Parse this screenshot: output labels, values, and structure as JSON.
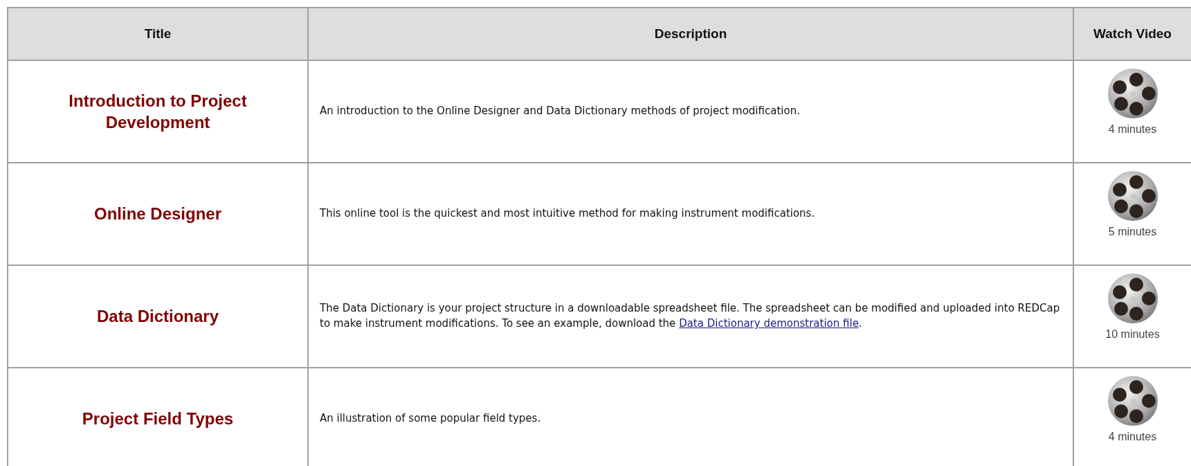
{
  "table": {
    "columns": [
      "Title",
      "Description",
      "Watch Video"
    ],
    "rows": [
      {
        "title": "Introduction to Project Development",
        "description": "An introduction to the Online Designer and Data Dictionary methods of project modification.",
        "duration": "4 minutes"
      },
      {
        "title": "Online Designer",
        "description": "This online tool is the quickest and most intuitive method for making instrument modifications.",
        "duration": "5 minutes"
      },
      {
        "title": "Data Dictionary",
        "description": "The Data Dictionary is your project structure in a downloadable spreadsheet file. The spreadsheet can be modified and uploaded into REDCap to make instrument modifications. To see an example, download the ",
        "link": "Data Dictionary demonstration file",
        "description_end": ".",
        "duration": "10 minutes"
      },
      {
        "title": "Project Field Types",
        "description": "An illustration of some popular field types.",
        "duration": "4 minutes"
      }
    ]
  }
}
